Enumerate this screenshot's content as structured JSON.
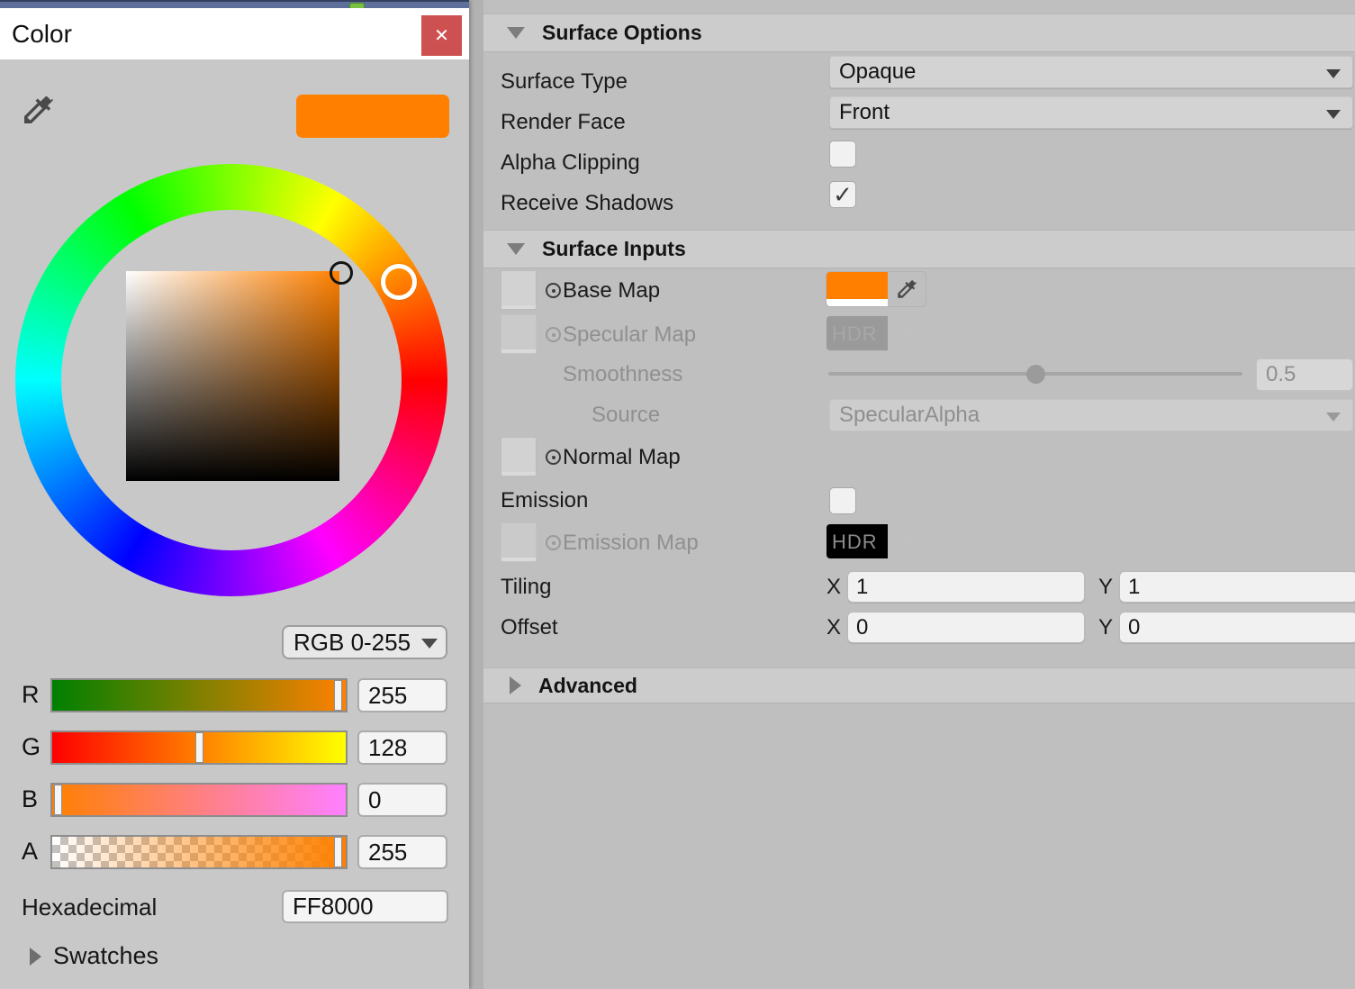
{
  "color_window": {
    "title": "Color",
    "close_glyph": "✕",
    "mode": "RGB 0-255",
    "preview_color": "#FF8000",
    "channels": {
      "r": {
        "label": "R",
        "value": "255"
      },
      "g": {
        "label": "G",
        "value": "128"
      },
      "b": {
        "label": "B",
        "value": "0"
      },
      "a": {
        "label": "A",
        "value": "255"
      }
    },
    "hex": {
      "label": "Hexadecimal",
      "value": "FF8000"
    },
    "swatches_label": "Swatches"
  },
  "inspector": {
    "surface_options": {
      "title": "Surface Options",
      "surface_type": {
        "label": "Surface Type",
        "value": "Opaque"
      },
      "render_face": {
        "label": "Render Face",
        "value": "Front"
      },
      "alpha_clipping": {
        "label": "Alpha Clipping"
      },
      "receive_shadows": {
        "label": "Receive Shadows",
        "checkmark": "✓"
      }
    },
    "surface_inputs": {
      "title": "Surface Inputs",
      "base_map": {
        "label": "Base Map",
        "color": "#FF8000"
      },
      "specular_map": {
        "label": "Specular Map",
        "hdr_badge": "HDR",
        "color": "#9a9a9a"
      },
      "smoothness": {
        "label": "Smoothness",
        "value": "0.5"
      },
      "source": {
        "label": "Source",
        "value": "SpecularAlpha"
      },
      "normal_map": {
        "label": "Normal Map"
      },
      "emission": {
        "label": "Emission"
      },
      "emission_map": {
        "label": "Emission Map",
        "hdr_badge": "HDR",
        "color": "#000000"
      },
      "tiling": {
        "label": "Tiling",
        "x_label": "X",
        "x": "1",
        "y_label": "Y",
        "y": "1"
      },
      "offset": {
        "label": "Offset",
        "x_label": "X",
        "x": "0",
        "y_label": "Y",
        "y": "0"
      }
    },
    "advanced": {
      "title": "Advanced"
    }
  }
}
